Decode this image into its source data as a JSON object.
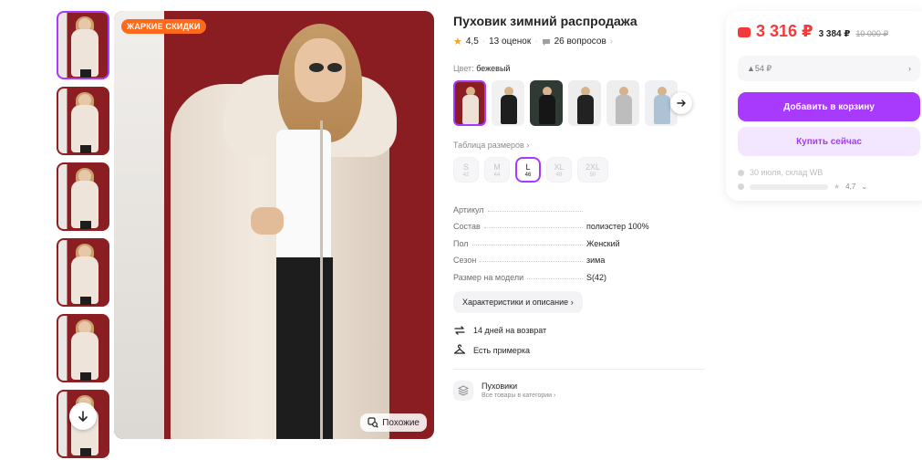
{
  "gallery": {
    "badge": "ЖАРКИЕ СКИДКИ",
    "similar_label": "Похожие",
    "thumbnail_count": 6
  },
  "product": {
    "title": "Пуховик зимний распродажа",
    "rating": "4,5",
    "reviews": "13 оценок",
    "questions": "26 вопросов",
    "color_label": "Цвет:",
    "color_value": "бежевый",
    "size_table_label": "Таблица размеров",
    "sizes": [
      {
        "label": "S",
        "ru": "42"
      },
      {
        "label": "M",
        "ru": "44"
      },
      {
        "label": "L",
        "ru": "46"
      },
      {
        "label": "XL",
        "ru": "48"
      },
      {
        "label": "2XL",
        "ru": "50"
      }
    ],
    "specs": [
      {
        "key": "Артикул",
        "value": "",
        "faded": true
      },
      {
        "key": "Состав",
        "value": "полиэстер 100%"
      },
      {
        "key": "Пол",
        "value": "Женский"
      },
      {
        "key": "Сезон",
        "value": "зима"
      },
      {
        "key": "Размер на модели",
        "value": "S(42)"
      }
    ],
    "chars_button": "Характеристики и описание",
    "return_label": "14 дней на возврат",
    "fitting_label": "Есть примерка",
    "category_title": "Пуховики",
    "category_sub": "Все товары в категории"
  },
  "purchase": {
    "price": "3 316 ₽",
    "price_mid": "3 384 ₽",
    "price_old": "10 000 ₽",
    "bonus": "▲54 ₽",
    "add_to_cart": "Добавить в корзину",
    "buy_now": "Купить сейчас",
    "delivery": "30 июля, склад WB",
    "seller_rating": "4,7"
  },
  "colors": {
    "accent": "#a73afd",
    "price_red": "#f23a3a",
    "badge_orange": "#ff6a1a"
  }
}
